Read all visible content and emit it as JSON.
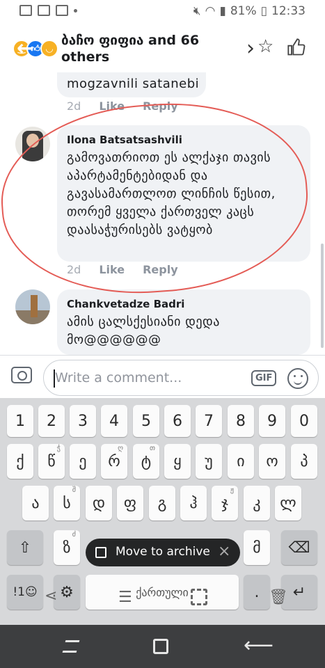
{
  "status_bar": {
    "battery": "81%",
    "time": "12:33"
  },
  "header": {
    "title": "ბაჩო ფიფია and 66 others",
    "reaction_icons": [
      "haha-icon",
      "like-icon",
      "sad-icon"
    ]
  },
  "comments": [
    {
      "name": "",
      "text": "mogzavnili  satanebi",
      "time": "2d",
      "like_label": "Like",
      "reply_label": "Reply"
    },
    {
      "name": "Ilona Batsatsashvili",
      "text": "გამოვათრიოთ ეს ალქაჯი თავის აპარტამენტებიდან და გავასამართლოთ ლინჩის წესით, თორემ ყველა ქართველ კაცს დაასაჭურისებს ვატყობ",
      "time": "2d",
      "like_label": "Like",
      "reply_label": "Reply"
    },
    {
      "name": "Chankvetadze Badri",
      "text": "ამის ცალსქესიანი დედა მო@@@@@@"
    }
  ],
  "composer": {
    "placeholder": "Write a comment...",
    "gif_label": "GIF"
  },
  "keyboard": {
    "row1": [
      "1",
      "2",
      "3",
      "4",
      "5",
      "6",
      "7",
      "8",
      "9",
      "0"
    ],
    "row2": [
      "ქ",
      "წ",
      "ე",
      "რ",
      "ტ",
      "ყ",
      "უ",
      "ი",
      "ო",
      "პ"
    ],
    "row2_hints": [
      "",
      "ჭ",
      "",
      "ღ",
      "თ",
      "",
      "",
      "",
      "",
      ""
    ],
    "row3": [
      "ა",
      "ს",
      "დ",
      "ფ",
      "გ",
      "ჰ",
      "ჯ",
      "კ",
      "ლ"
    ],
    "row3_hints": [
      "",
      "შ",
      "",
      "",
      "",
      "",
      "ჟ",
      "",
      ""
    ],
    "row4": [
      "ზ",
      "მ"
    ],
    "row4_hints": [
      "ძ",
      ""
    ],
    "language_label": "ქართული",
    "symbols_label": "!1☺",
    "period_label": "."
  },
  "toast": {
    "label": "Move to archive"
  }
}
